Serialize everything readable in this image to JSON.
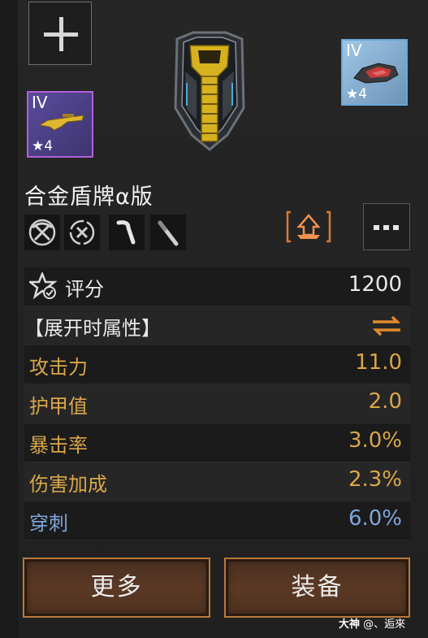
{
  "top": {
    "add_icon": "plus-icon"
  },
  "item": {
    "name": "合金盾牌α版",
    "icon": "alloy-shield-icon",
    "slot_left": {
      "tier": "IV",
      "stars": "★4",
      "icon": "golden-rifle-icon",
      "border_color": "#b060d8"
    },
    "slot_right": {
      "tier": "IV",
      "stars": "★4",
      "icon": "red-mech-part-icon",
      "border_color": "#6aa8d8"
    }
  },
  "skill_icons": [
    "pickaxe-icon",
    "cancel-circle-icon",
    "hook-icon",
    "blade-icon"
  ],
  "set_icon": "set-bonus-icon",
  "more_icon": "more-options-icon",
  "stats": {
    "score_label": "评分",
    "score_value": "1200",
    "expand_label": "【展开时属性】",
    "rows": [
      {
        "label": "攻击力",
        "value": "11.0",
        "color": "#d9a64a"
      },
      {
        "label": "护甲值",
        "value": "2.0",
        "color": "#d9a64a"
      },
      {
        "label": "暴击率",
        "value": "3.0%",
        "color": "#d9a64a"
      },
      {
        "label": "伤害加成",
        "value": "2.3%",
        "color": "#d9a64a"
      },
      {
        "label": "穿刺",
        "value": "6.0%",
        "color": "#7fa6d9"
      }
    ]
  },
  "buttons": {
    "more": "更多",
    "equip": "装备"
  },
  "watermark": {
    "brand": "大神",
    "user": "@、逅來"
  }
}
